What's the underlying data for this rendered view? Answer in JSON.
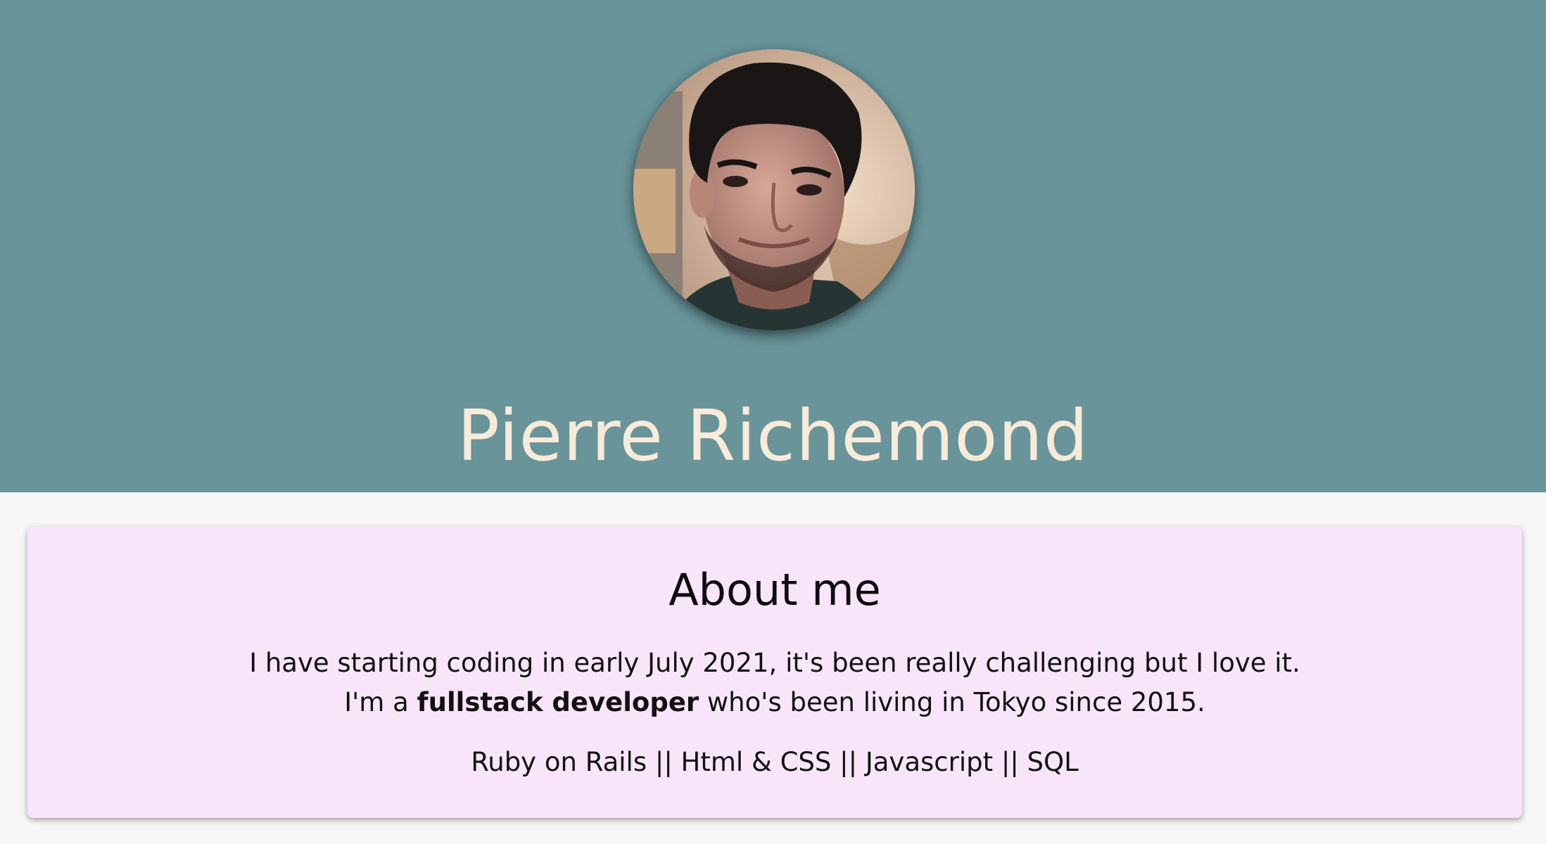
{
  "header": {
    "name": "Pierre Richemond",
    "avatar_alt": "Portrait photo of Pierre Richemond",
    "background_color": "#68949a",
    "name_color": "#f8ebd9"
  },
  "about": {
    "title": "About me",
    "line1": "I have starting coding in early July 2021, it's been really challenging but I love it.",
    "line2_prefix": "I'm a ",
    "line2_bold": "fullstack developer",
    "line2_suffix": " who's been living in Tokyo since 2015.",
    "skills": "Ruby on Rails || Html & CSS || Javascript || SQL",
    "card_color": "#f9e5f9"
  }
}
